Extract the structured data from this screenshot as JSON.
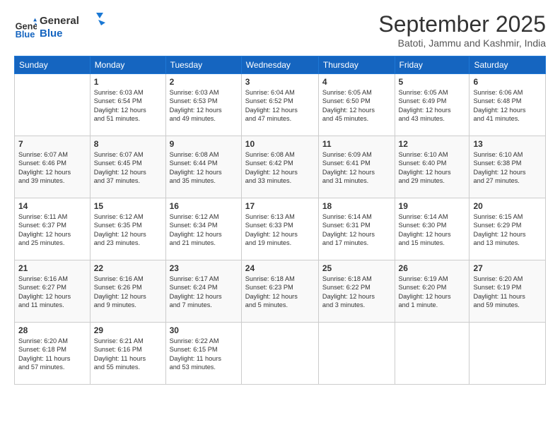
{
  "header": {
    "logo_line1": "General",
    "logo_line2": "Blue",
    "month": "September 2025",
    "location": "Batoti, Jammu and Kashmir, India"
  },
  "weekdays": [
    "Sunday",
    "Monday",
    "Tuesday",
    "Wednesday",
    "Thursday",
    "Friday",
    "Saturday"
  ],
  "weeks": [
    [
      {
        "day": "",
        "info": ""
      },
      {
        "day": "1",
        "info": "Sunrise: 6:03 AM\nSunset: 6:54 PM\nDaylight: 12 hours\nand 51 minutes."
      },
      {
        "day": "2",
        "info": "Sunrise: 6:03 AM\nSunset: 6:53 PM\nDaylight: 12 hours\nand 49 minutes."
      },
      {
        "day": "3",
        "info": "Sunrise: 6:04 AM\nSunset: 6:52 PM\nDaylight: 12 hours\nand 47 minutes."
      },
      {
        "day": "4",
        "info": "Sunrise: 6:05 AM\nSunset: 6:50 PM\nDaylight: 12 hours\nand 45 minutes."
      },
      {
        "day": "5",
        "info": "Sunrise: 6:05 AM\nSunset: 6:49 PM\nDaylight: 12 hours\nand 43 minutes."
      },
      {
        "day": "6",
        "info": "Sunrise: 6:06 AM\nSunset: 6:48 PM\nDaylight: 12 hours\nand 41 minutes."
      }
    ],
    [
      {
        "day": "7",
        "info": "Sunrise: 6:07 AM\nSunset: 6:46 PM\nDaylight: 12 hours\nand 39 minutes."
      },
      {
        "day": "8",
        "info": "Sunrise: 6:07 AM\nSunset: 6:45 PM\nDaylight: 12 hours\nand 37 minutes."
      },
      {
        "day": "9",
        "info": "Sunrise: 6:08 AM\nSunset: 6:44 PM\nDaylight: 12 hours\nand 35 minutes."
      },
      {
        "day": "10",
        "info": "Sunrise: 6:08 AM\nSunset: 6:42 PM\nDaylight: 12 hours\nand 33 minutes."
      },
      {
        "day": "11",
        "info": "Sunrise: 6:09 AM\nSunset: 6:41 PM\nDaylight: 12 hours\nand 31 minutes."
      },
      {
        "day": "12",
        "info": "Sunrise: 6:10 AM\nSunset: 6:40 PM\nDaylight: 12 hours\nand 29 minutes."
      },
      {
        "day": "13",
        "info": "Sunrise: 6:10 AM\nSunset: 6:38 PM\nDaylight: 12 hours\nand 27 minutes."
      }
    ],
    [
      {
        "day": "14",
        "info": "Sunrise: 6:11 AM\nSunset: 6:37 PM\nDaylight: 12 hours\nand 25 minutes."
      },
      {
        "day": "15",
        "info": "Sunrise: 6:12 AM\nSunset: 6:35 PM\nDaylight: 12 hours\nand 23 minutes."
      },
      {
        "day": "16",
        "info": "Sunrise: 6:12 AM\nSunset: 6:34 PM\nDaylight: 12 hours\nand 21 minutes."
      },
      {
        "day": "17",
        "info": "Sunrise: 6:13 AM\nSunset: 6:33 PM\nDaylight: 12 hours\nand 19 minutes."
      },
      {
        "day": "18",
        "info": "Sunrise: 6:14 AM\nSunset: 6:31 PM\nDaylight: 12 hours\nand 17 minutes."
      },
      {
        "day": "19",
        "info": "Sunrise: 6:14 AM\nSunset: 6:30 PM\nDaylight: 12 hours\nand 15 minutes."
      },
      {
        "day": "20",
        "info": "Sunrise: 6:15 AM\nSunset: 6:29 PM\nDaylight: 12 hours\nand 13 minutes."
      }
    ],
    [
      {
        "day": "21",
        "info": "Sunrise: 6:16 AM\nSunset: 6:27 PM\nDaylight: 12 hours\nand 11 minutes."
      },
      {
        "day": "22",
        "info": "Sunrise: 6:16 AM\nSunset: 6:26 PM\nDaylight: 12 hours\nand 9 minutes."
      },
      {
        "day": "23",
        "info": "Sunrise: 6:17 AM\nSunset: 6:24 PM\nDaylight: 12 hours\nand 7 minutes."
      },
      {
        "day": "24",
        "info": "Sunrise: 6:18 AM\nSunset: 6:23 PM\nDaylight: 12 hours\nand 5 minutes."
      },
      {
        "day": "25",
        "info": "Sunrise: 6:18 AM\nSunset: 6:22 PM\nDaylight: 12 hours\nand 3 minutes."
      },
      {
        "day": "26",
        "info": "Sunrise: 6:19 AM\nSunset: 6:20 PM\nDaylight: 12 hours\nand 1 minute."
      },
      {
        "day": "27",
        "info": "Sunrise: 6:20 AM\nSunset: 6:19 PM\nDaylight: 11 hours\nand 59 minutes."
      }
    ],
    [
      {
        "day": "28",
        "info": "Sunrise: 6:20 AM\nSunset: 6:18 PM\nDaylight: 11 hours\nand 57 minutes."
      },
      {
        "day": "29",
        "info": "Sunrise: 6:21 AM\nSunset: 6:16 PM\nDaylight: 11 hours\nand 55 minutes."
      },
      {
        "day": "30",
        "info": "Sunrise: 6:22 AM\nSunset: 6:15 PM\nDaylight: 11 hours\nand 53 minutes."
      },
      {
        "day": "",
        "info": ""
      },
      {
        "day": "",
        "info": ""
      },
      {
        "day": "",
        "info": ""
      },
      {
        "day": "",
        "info": ""
      }
    ]
  ]
}
